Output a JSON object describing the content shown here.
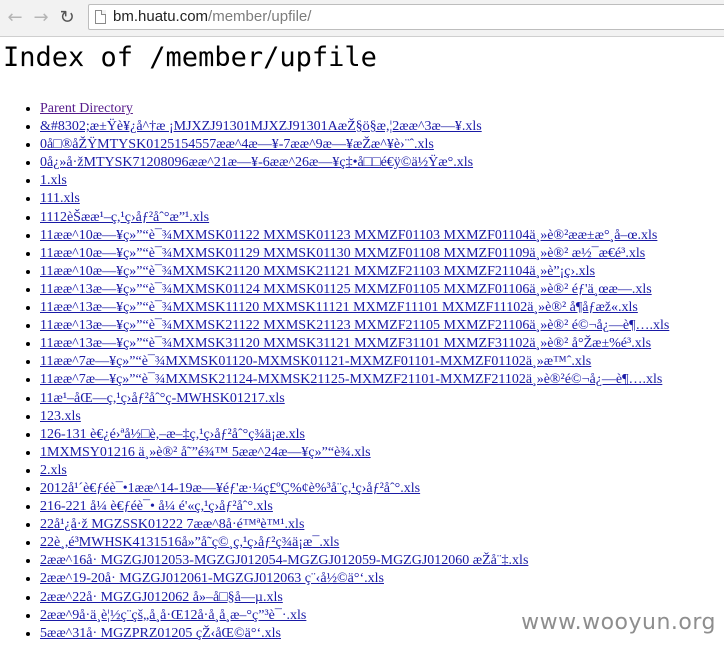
{
  "browser": {
    "url_host": "bm.huatu.com",
    "url_path": "/member/upfile/"
  },
  "page": {
    "heading": "Index of /member/upfile"
  },
  "files": [
    "Parent Directory",
    "&#8302;æ±Ÿè¥¿å^†æ ¡MJXZJ91301MJXZJ91301AæŽ§ö§æ,¦2ææ^3æ—¥.xls",
    "0å□®åŽŸMTYSK0125154557ææ^4æ—¥-7ææ^9æ—¥æŽæ^¥è›¨ˆ.xls",
    "0å¿»å·žMTYSK71208096ææ^21æ—¥-6ææ^26æ—¥ç‡•å□□é€ÿ©ä½Ÿæ°.xls",
    "1.xls",
    "111.xls",
    "1112èŠææ¹–ç,¹ç›åƒ²åˆ°æ”¹.xls",
    "11ææ^10æ—¥ç»”“è¯¾MXMSK01122 MXMSK01123 MXMZF01103 MXMZF01104ä¸»è®²ææ±æ°¸å–œ.xls",
    "11ææ^10æ—¥ç»”“è¯¾MXMSK01129 MXMSK01130 MXMZF01108 MXMZF01109ä¸»è®² æ½¯æ€é³.xls",
    "11ææ^10æ—¥ç»”“è¯¾MXMSK21120 MXMSK21121 MXMZF21103 MXMZF21104ä¸»è”¡ç›.xls",
    "11ææ^13æ—¥ç»”“è¯¾MXMSK01124 MXMSK01125 MXMZF01105 MXMZF01106ä¸»è®² éƒ'ä¸œæ—.xls",
    "11ææ^13æ—¥ç»”“è¯¾MXMSK11120 MXMSK11121 MXMZF11101 MXMZF11102ä¸»è®² å¶åƒæž«.xls",
    "11ææ^13æ—¥ç»”“è¯¾MXMSK21122 MXMSK21123 MXMZF21105 MXMZF21106ä¸»è®² é©¬å¿—è¶….xls",
    "11ææ^13æ—¥ç»”“è¯¾MXMSK31120 MXMSK31121 MXMZF31101 MXMZF31102ä¸»è®² å°Žæ±%é³.xls",
    "11ææ^7æ—¥ç»”“è¯¾MXMSK01120-MXMSK01121-MXMZF01101-MXMZF01102ä¸»æ™ˆ.xls",
    "11ææ^7æ—¥ç»”“è¯¾MXMSK21124-MXMSK21125-MXMZF21101-MXMZF21102ä¸»è®²é©¬å¿—è¶….xls",
    "11æ¹–åŒ—ç,¹ç›åƒ²åˆ°ç-MWHSK01217.xls",
    "123.xls",
    "126-131 è€¿é›ªå½□è,–æ–‡ç,¹ç›åƒ²åˆ°ç­¾ä¡æ.xls",
    "1MXMSY01216 ä¸»è®² å˜”é¾™ 5ææ^24æ—¥ç»”“è¾.xls",
    "2.xls",
    "2012å¹´è€ƒéè¯•1ææ^14-19æ—¥éƒ'æ·¼ç£ºÇ%¢è%³å¨ç,¹ç›åƒ²åˆ°.xls",
    "216-221 å¼ è€ƒéè¯• å¼ é'«ç,¹ç›åƒ²åˆ°.xls",
    "22å¹¿å·ž MGZSSK01222 7ææ^8å·é™ªè™¹.xls",
    "22è¸,é³MWHSK4131516å»”å˜ç©¸ç,¹ç›åƒ²ç­¾ä¡æ¯.xls",
    "2ææ^16å· MGZGJ012053-MGZGJ012054-MGZGJ012059-MGZGJ012060 æŽå¨‡.xls",
    "2ææ^19-20å· MGZGJ012061-MGZGJ012063 ç¨‹å½©ä°‘.xls",
    "2ææ^22å· MGZGJ012062 å»–å□§å—µ.xls",
    "2ææ^9å·ä¸è¦½ç¨çš„å¸å·Œ12å·å¸å¸æ–°ç”³è¯·.xls",
    "5ææ^31å· MGZPRZ01205 çŽ‹åŒ©ä°‘.xls"
  ],
  "watermark": "www.wooyun.org"
}
